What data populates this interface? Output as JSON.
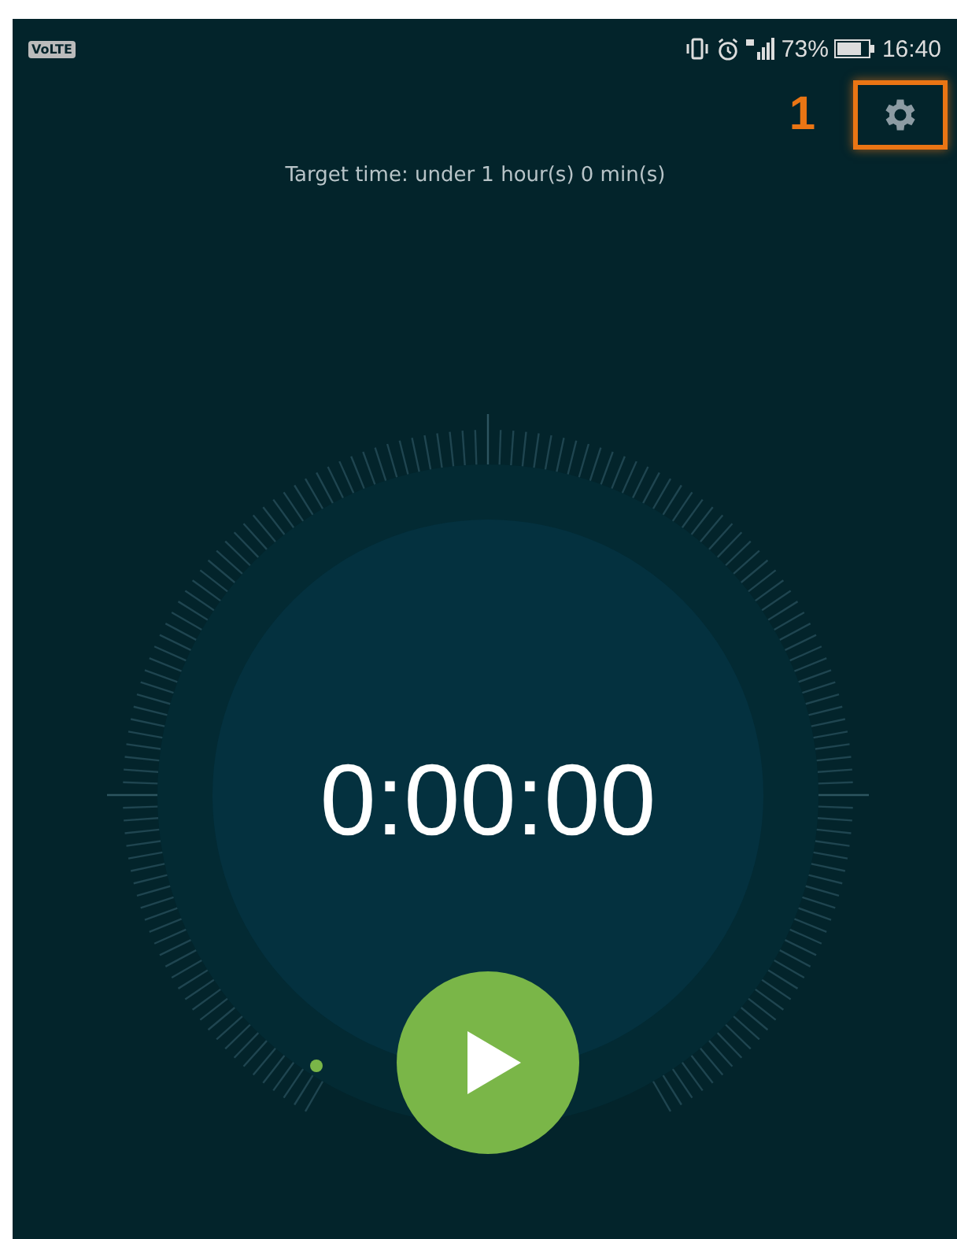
{
  "status_bar": {
    "network_badge": "VoLTE",
    "battery": "73%",
    "time": "16:40"
  },
  "toolbar": {
    "callout": "1"
  },
  "target_text": "Target time: under 1 hour(s) 0 min(s)",
  "timer": {
    "display": "0:00:00"
  }
}
